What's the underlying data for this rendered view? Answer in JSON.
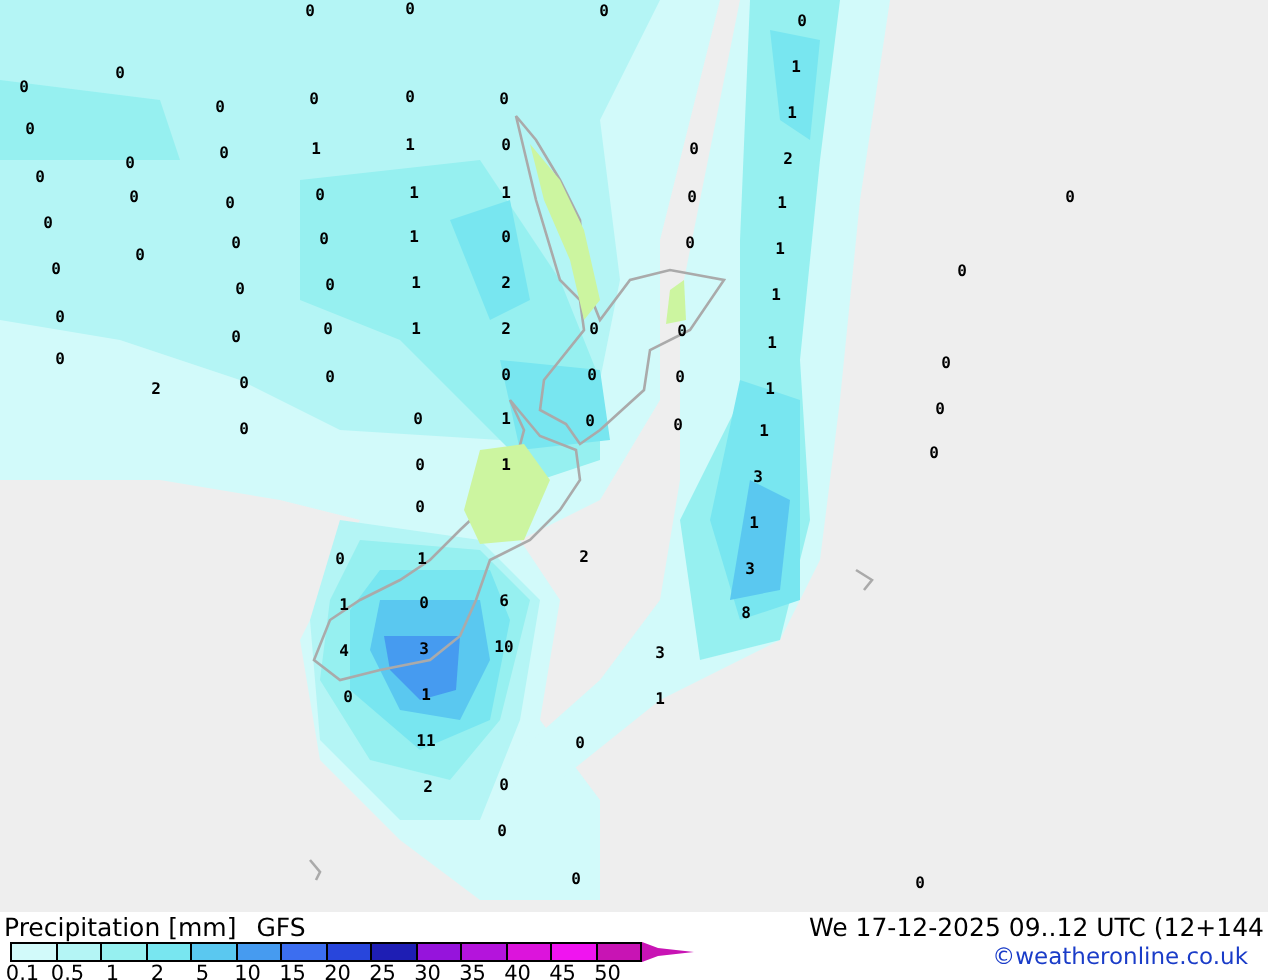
{
  "map": {
    "values": [
      "0",
      "0",
      "0",
      "0",
      "0",
      "0",
      "0",
      "0",
      "0",
      "0",
      "0",
      "0",
      "1",
      "1",
      "0",
      "0",
      "0",
      "0",
      "0",
      "1",
      "1",
      "0",
      "0",
      "0",
      "0",
      "1",
      "0",
      "0",
      "0",
      "0",
      "1",
      "2",
      "0",
      "0",
      "1",
      "2",
      "0",
      "0",
      "0",
      "0",
      "2",
      "0",
      "0",
      "0",
      "1",
      "0",
      "1",
      "0",
      "1",
      "1",
      "2",
      "1",
      "1",
      "1",
      "1",
      "1",
      "1",
      "3",
      "1",
      "3",
      "8",
      "3",
      "1",
      "0",
      "0",
      "0",
      "0",
      "0",
      "0",
      "0",
      "0",
      "0",
      "2",
      "0",
      "0",
      "0",
      "0",
      "0",
      "0",
      "0",
      "0",
      "1",
      "1",
      "0",
      "6",
      "4",
      "3",
      "10",
      "0",
      "1",
      "11",
      "2",
      "0",
      "0",
      "0",
      "0"
    ]
  },
  "title": "Precipitation [mm]",
  "model": "GFS",
  "valid": "We 17-12-2025 09..12 UTC (12+144",
  "credit": "©weatheronline.co.uk",
  "legend": [
    {
      "label": "0.1",
      "color": "#d2fafa"
    },
    {
      "label": "0.5",
      "color": "#b4f5f5"
    },
    {
      "label": "1",
      "color": "#96f0f0"
    },
    {
      "label": "2",
      "color": "#78e6f0"
    },
    {
      "label": "5",
      "color": "#5ac8f0"
    },
    {
      "label": "10",
      "color": "#469bf0"
    },
    {
      "label": "15",
      "color": "#3c6ef0"
    },
    {
      "label": "20",
      "color": "#2846dc"
    },
    {
      "label": "25",
      "color": "#1e1eb4"
    },
    {
      "label": "30",
      "color": "#9614dc"
    },
    {
      "label": "35",
      "color": "#b414dc"
    },
    {
      "label": "40",
      "color": "#dc14dc"
    },
    {
      "label": "45",
      "color": "#f014f0"
    },
    {
      "label": "50",
      "color": "#c814b4"
    }
  ]
}
